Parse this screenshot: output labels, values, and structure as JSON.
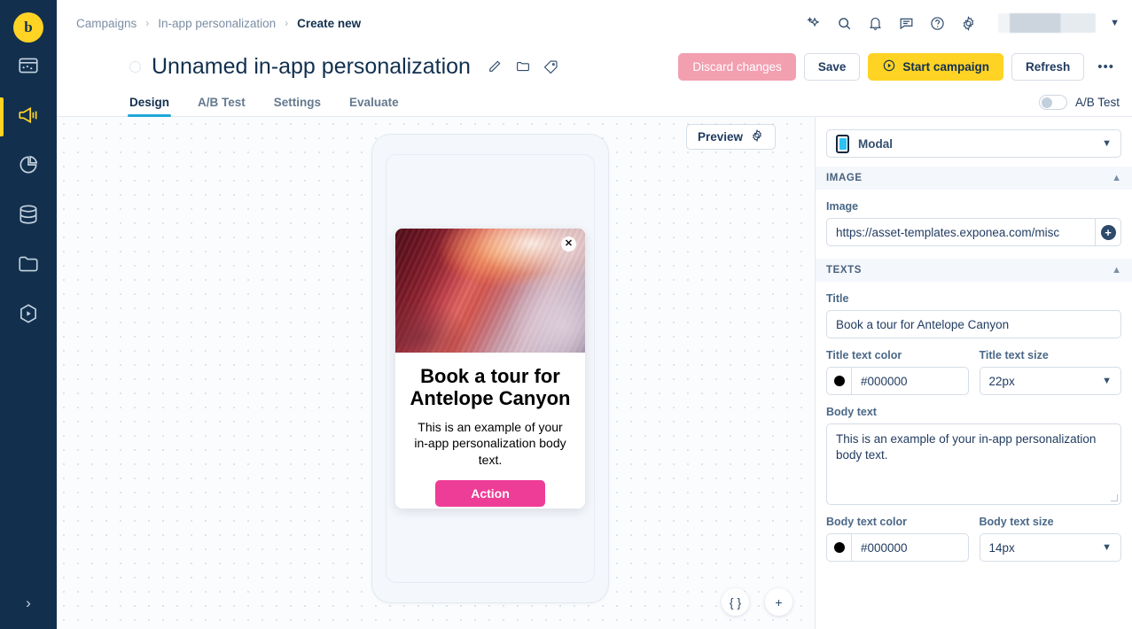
{
  "sidebar": {
    "logo": "b",
    "items": [
      {
        "name": "dashboard",
        "icon": "dashboard-icon",
        "active": false
      },
      {
        "name": "campaigns",
        "icon": "megaphone-icon",
        "active": true
      },
      {
        "name": "analytics",
        "icon": "pie-chart-icon",
        "active": false
      },
      {
        "name": "data",
        "icon": "database-icon",
        "active": false
      },
      {
        "name": "assets",
        "icon": "folder-icon",
        "active": false
      },
      {
        "name": "scenarios",
        "icon": "play-icon",
        "active": false
      }
    ],
    "expand": "›"
  },
  "breadcrumbs": [
    {
      "label": "Campaigns",
      "current": false
    },
    {
      "label": "In-app personalization",
      "current": false
    },
    {
      "label": "Create new",
      "current": true
    }
  ],
  "breadcrumb_separator": "›",
  "topbar_icons": [
    "sparkle-icon",
    "search-icon",
    "bell-icon",
    "comment-icon",
    "help-icon",
    "gear-icon"
  ],
  "header": {
    "title": "Unnamed in-app personalization",
    "icons": [
      "pencil-icon",
      "folder-icon",
      "tag-icon"
    ]
  },
  "actions": {
    "discard": "Discard changes",
    "save": "Save",
    "start": "Start campaign",
    "refresh": "Refresh",
    "more": "•••"
  },
  "tabs": [
    {
      "label": "Design",
      "active": true
    },
    {
      "label": "A/B Test",
      "active": false
    },
    {
      "label": "Settings",
      "active": false
    },
    {
      "label": "Evaluate",
      "active": false
    }
  ],
  "abtest": {
    "label": "A/B Test",
    "enabled": false
  },
  "canvas": {
    "preview_label": "Preview",
    "fabs": [
      "{ }",
      "+"
    ]
  },
  "modal_preview": {
    "close": "✕",
    "title": "Book a tour for Antelope Canyon",
    "body": "This is an example of your in-app personalization body text.",
    "action_label": "Action",
    "action_color": "#ee3d96",
    "title_color": "#000000",
    "body_color": "#000000"
  },
  "panel": {
    "type_select": {
      "label": "Modal",
      "icon": "phone-icon"
    },
    "sections": [
      {
        "key": "image",
        "title": "IMAGE",
        "expanded": true
      },
      {
        "key": "texts",
        "title": "TEXTS",
        "expanded": true
      }
    ],
    "image": {
      "label": "Image",
      "value": "https://asset-templates.exponea.com/misc",
      "add_button": "+"
    },
    "texts": {
      "title_label": "Title",
      "title_value": "Book a tour for Antelope Canyon",
      "title_color_label": "Title text color",
      "title_color_value": "#000000",
      "title_size_label": "Title text size",
      "title_size_value": "22px",
      "body_label": "Body text",
      "body_value": "This is an example of your in-app personalization body text.",
      "body_color_label": "Body text color",
      "body_color_value": "#000000",
      "body_size_label": "Body text size",
      "body_size_value": "14px"
    }
  }
}
